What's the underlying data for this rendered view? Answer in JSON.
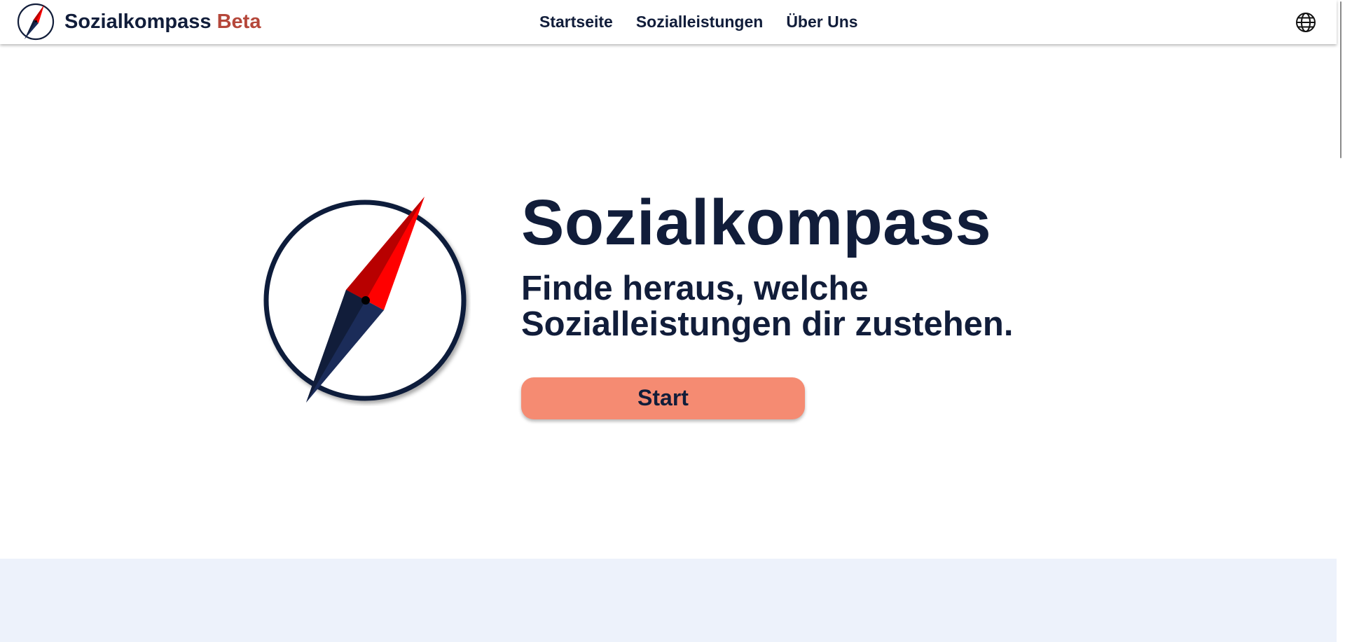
{
  "header": {
    "brand_name": "Sozialkompass",
    "brand_badge": "Beta",
    "nav": [
      {
        "label": "Startseite"
      },
      {
        "label": "Sozialleistungen"
      },
      {
        "label": "Über Uns"
      }
    ],
    "language_icon": "globe-icon"
  },
  "hero": {
    "title": "Sozialkompass",
    "subtitle": "Finde heraus, welche Sozialleistungen dir zustehen.",
    "start_label": "Start",
    "logo_icon": "compass-icon"
  },
  "colors": {
    "navy": "#111d3a",
    "beta": "#b5473a",
    "button": "#f58b72",
    "needle_red": "#ff0000",
    "band": "#edf2fb"
  }
}
